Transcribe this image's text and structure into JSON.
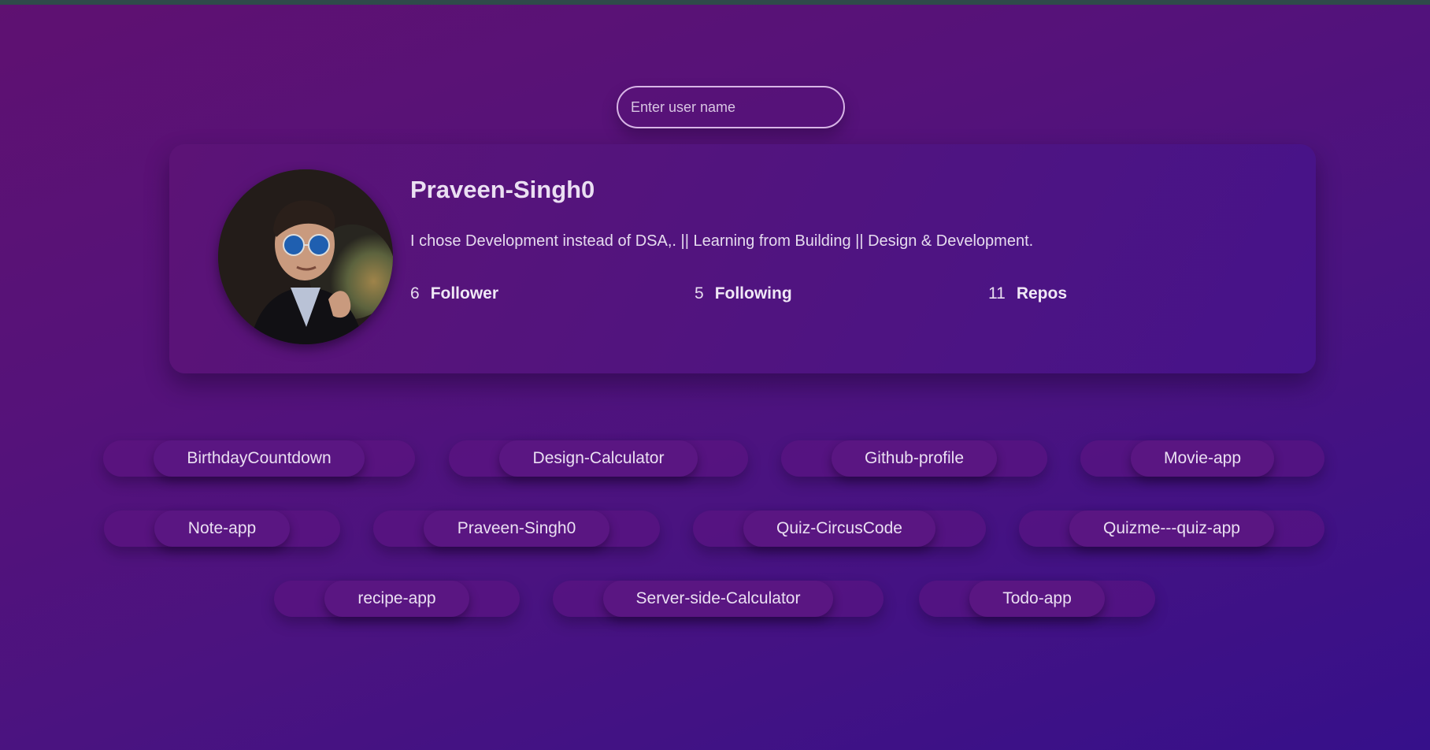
{
  "search": {
    "placeholder": "Enter user name",
    "value": ""
  },
  "profile": {
    "name": "Praveen-Singh0",
    "bio": "I chose Development instead of DSA,. || Learning from Building || Design & Development.",
    "stats": {
      "followers_count": "6",
      "followers_label": "Follower",
      "following_count": "5",
      "following_label": "Following",
      "repos_count": "11",
      "repos_label": "Repos"
    }
  },
  "repos": [
    "BirthdayCountdown",
    "Design-Calculator",
    "Github-profile",
    "Movie-app",
    "Note-app",
    "Praveen-Singh0",
    "Quiz-CircusCode",
    "Quizme---quiz-app",
    "recipe-app",
    "Server-side-Calculator",
    "Todo-app"
  ],
  "colors": {
    "background_start": "#5f1171",
    "background_end": "#36108a",
    "card": "#55137b",
    "pill": "#5a1682",
    "text": "#eadff2"
  }
}
